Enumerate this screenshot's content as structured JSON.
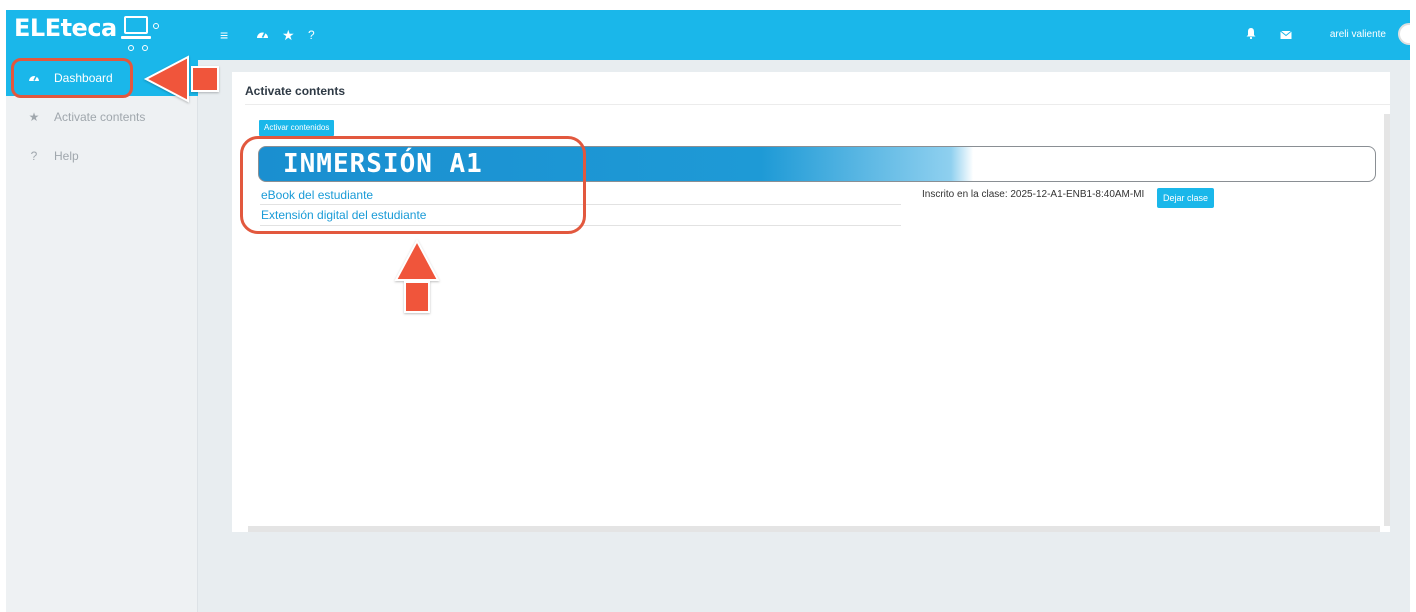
{
  "app": {
    "logo_text": "ELEteca"
  },
  "header": {
    "icons": [
      "menu-icon",
      "dashboard-icon",
      "star-icon",
      "help-icon"
    ],
    "help_glyph": "?",
    "user_name": "areli valiente"
  },
  "sidebar": {
    "items": [
      {
        "label": "Dashboard",
        "icon": "dashboard-icon",
        "active": true
      },
      {
        "label": "Activate contents",
        "icon": "star-icon",
        "active": false
      },
      {
        "label": "Help",
        "icon": "help-icon",
        "glyph": "?",
        "active": false
      }
    ]
  },
  "main": {
    "title": "Activate contents",
    "activate_button": "Activar contenidos",
    "course": {
      "title": "INMERSIÓN A1",
      "resources": [
        "eBook del estudiante",
        "Extensión digital del estudiante"
      ],
      "enrolled_text": "Inscrito en la clase: 2025-12-A1-ENB1-8:40AM-MI",
      "leave_button": "Dejar clase"
    }
  },
  "colors": {
    "accent": "#1ab7ea",
    "annotation": "#e2583e",
    "arrow_fill": "#f0553b"
  }
}
